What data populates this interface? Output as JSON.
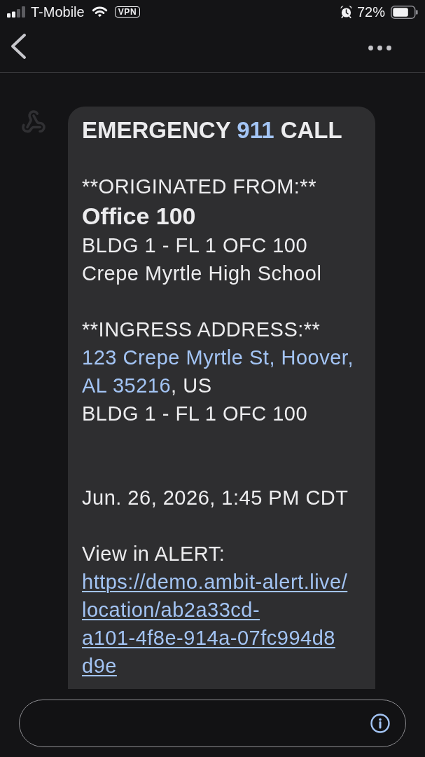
{
  "status_bar": {
    "carrier": "T-Mobile",
    "vpn_label": "VPN",
    "battery_percent": "72%"
  },
  "message": {
    "paragraphs": [
      {
        "kind": "heading",
        "lines": [
          {
            "kind": "title",
            "parts": [
              {
                "kind": "text",
                "text": "EMERGENCY "
              },
              {
                "kind": "link",
                "text": "911"
              },
              {
                "kind": "text",
                "text": " CALL"
              }
            ]
          }
        ]
      },
      {
        "kind": "section",
        "lines": [
          {
            "kind": "label",
            "parts": [
              {
                "kind": "text",
                "text": "**ORIGINATED FROM:**"
              }
            ]
          },
          {
            "kind": "name",
            "parts": [
              {
                "kind": "text",
                "text": "Office 100"
              }
            ]
          },
          {
            "kind": "text",
            "parts": [
              {
                "kind": "text",
                "text": "BLDG 1 - FL 1 OFC 100"
              }
            ]
          },
          {
            "kind": "text",
            "parts": [
              {
                "kind": "text",
                "text": "Crepe Myrtle High School"
              }
            ]
          }
        ]
      },
      {
        "kind": "section",
        "lines": [
          {
            "kind": "label",
            "parts": [
              {
                "kind": "text",
                "text": "**INGRESS ADDRESS:**"
              }
            ]
          },
          {
            "kind": "text",
            "parts": [
              {
                "kind": "link",
                "text": "123 Crepe Myrtle St, Hoover,"
              }
            ]
          },
          {
            "kind": "text",
            "parts": [
              {
                "kind": "link",
                "text": "AL 35216"
              },
              {
                "kind": "text",
                "text": ", US"
              }
            ]
          },
          {
            "kind": "text",
            "parts": [
              {
                "kind": "text",
                "text": "BLDG 1 - FL 1 OFC 100"
              }
            ]
          }
        ]
      },
      {
        "kind": "timestamp",
        "lines": [
          {
            "kind": "text",
            "parts": [
              {
                "kind": "text",
                "text": "Jun. 26, 2026, 1:45 PM CDT"
              }
            ]
          }
        ]
      },
      {
        "kind": "action",
        "lines": [
          {
            "kind": "text",
            "parts": [
              {
                "kind": "text",
                "text": "View in ALERT:"
              }
            ]
          },
          {
            "kind": "url",
            "text_lines": [
              "https://demo.ambit-alert.live/",
              "location/ab2a33cd-",
              "a101-4f8e-914a-07fc994d8",
              "d9e"
            ]
          }
        ]
      }
    ]
  }
}
